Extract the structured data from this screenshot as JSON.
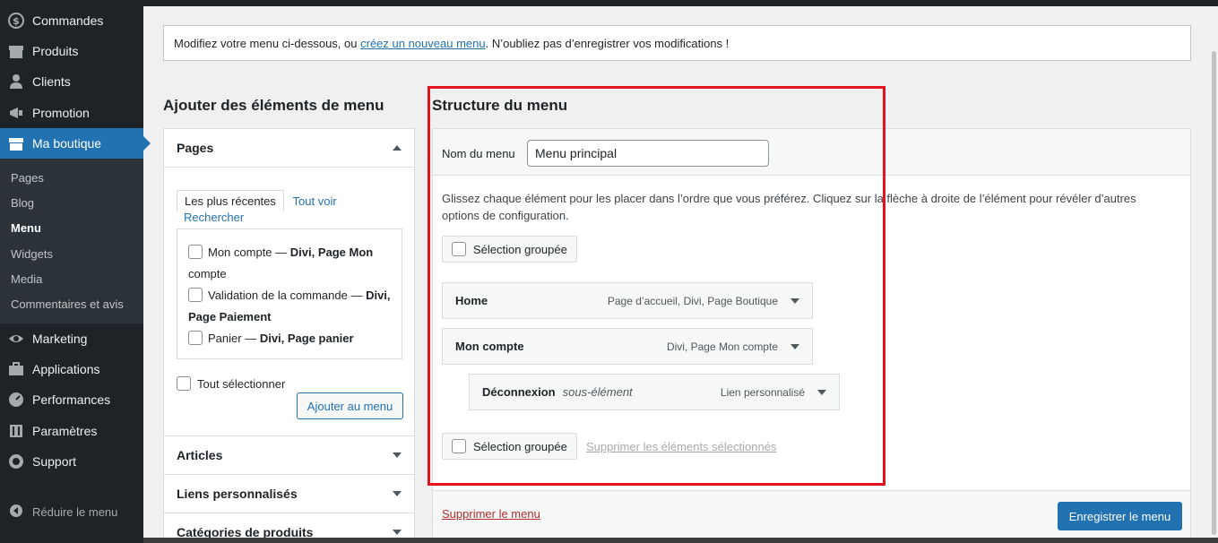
{
  "sidebar": {
    "items": [
      {
        "label": "Commandes",
        "icon": "dollar-icon"
      },
      {
        "label": "Produits",
        "icon": "archive-icon"
      },
      {
        "label": "Clients",
        "icon": "user-icon"
      },
      {
        "label": "Promotion",
        "icon": "megaphone-icon"
      },
      {
        "label": "Ma boutique",
        "icon": "store-icon"
      }
    ],
    "submenu": [
      "Pages",
      "Blog",
      "Menu",
      "Widgets",
      "Media",
      "Commentaires et avis"
    ],
    "items_bottom": [
      {
        "label": "Marketing",
        "icon": "visibility-icon"
      },
      {
        "label": "Applications",
        "icon": "briefcase-icon"
      },
      {
        "label": "Performances",
        "icon": "gauge-icon"
      },
      {
        "label": "Paramètres",
        "icon": "sliders-icon"
      },
      {
        "label": "Support",
        "icon": "lifebuoy-icon"
      }
    ],
    "collapse_label": "Réduire le menu"
  },
  "notice": {
    "before": "Modifiez votre menu ci-dessous, ou ",
    "link": "créez un nouveau menu",
    "after": ". N’oubliez pas d’enregistrer vos modifications !"
  },
  "left": {
    "title": "Ajouter des éléments de menu",
    "pages": {
      "heading": "Pages",
      "tab_recent": "Les plus récentes",
      "tab_all": "Tout voir",
      "tab_search": "Rechercher",
      "items": [
        {
          "label": "Mon compte — ",
          "bold": "Divi, Page Mon",
          "rest": "compte"
        },
        {
          "label": "Validation de la commande — ",
          "bold": "Divi,",
          "rest": "Page Paiement"
        },
        {
          "label": "Panier — ",
          "bold": "Divi, Page panier",
          "rest": ""
        }
      ],
      "select_all": "Tout sélectionner",
      "add_button": "Ajouter au menu"
    },
    "sections": [
      "Articles",
      "Liens personnalisés",
      "Catégories de produits"
    ]
  },
  "right": {
    "title": "Structure du menu",
    "name_label": "Nom du menu",
    "name_value": "Menu principal",
    "instructions": "Glissez chaque élément pour les placer dans l’ordre que vous préférez. Cliquez sur la flèche à droite de l’élément pour révéler d’autres options de configuration.",
    "bulk_select": "Sélection groupée",
    "menu_items": [
      {
        "title": "Home",
        "sub": "",
        "type": "Page d’accueil, Divi, Page Boutique"
      },
      {
        "title": "Mon compte",
        "sub": "",
        "type": "Divi, Page Mon compte"
      },
      {
        "title": "Déconnexion",
        "sub": "sous-élément",
        "type": "Lien personnalisé"
      }
    ],
    "delete_selected": "Supprimer les éléments sélectionnés",
    "delete_menu": "Supprimer le menu",
    "save_button": "Enregistrer le menu"
  },
  "colors": {
    "accent": "#2271b1",
    "highlight": "#e3141d",
    "sidebar": "#1d2327"
  }
}
